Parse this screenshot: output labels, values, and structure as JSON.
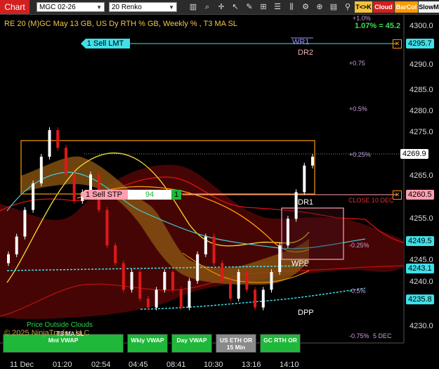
{
  "toolbar": {
    "title": "Chart",
    "instrument": "MGC 02-26",
    "bar_type": "20 Renko",
    "buttons": [
      "T<>K",
      "Cloud",
      "BarCol",
      "SlowM"
    ],
    "icons": [
      "dropdown-arrow",
      "dropdown-arrow",
      "bar-chart-icon",
      "magnify-icon",
      "crosshair-icon",
      "arrow-icon",
      "draw-icon",
      "template-icon",
      "properties-icon",
      "candle-icon",
      "zoom-icon",
      "data-box-icon"
    ]
  },
  "chart_header": {
    "title": "RE 20  (M)GC May 13 GB, US Dy RTH % GB, Weekly % , T3 MA SL",
    "pct_readout": "1.07% = 45.2",
    "top_label": "+1.0%"
  },
  "orders": {
    "limit_label": "1 Sell LMT",
    "limit_price": "4295.7",
    "stop_label": "1 Sell STP",
    "stop_qty_mid": "94",
    "stop_qty": "1",
    "stop_price": "4260.5",
    "close_label": "CLOSE 10 DEC",
    "cancel_glyph": "✕"
  },
  "price_tags": {
    "last": "4269.9",
    "t1": "4249.5",
    "t2": "4243.1",
    "t3": "4235.8"
  },
  "levels": {
    "wr1": "WR1",
    "dr2": "DR2",
    "dr1": "DR1",
    "wpp": "WPP",
    "dpp": "DPP"
  },
  "pct_labels": {
    "p075": "+0.75",
    "p05": "+0.5%",
    "p025": "+0.25%",
    "m025": "-0.25%",
    "m05": "-0.5%",
    "m075": "-0.75%",
    "dec5": "5 DEC"
  },
  "y_axis": [
    "4300.0",
    "4290.0",
    "4285.0",
    "4280.0",
    "4275.0",
    "4265.0",
    "4255.0",
    "4245.0",
    "4240.0",
    "4230.0"
  ],
  "x_axis": [
    "11 Dec",
    "01:20",
    "02:54",
    "04:45",
    "08:41",
    "10:30",
    "13:16",
    "14:10"
  ],
  "bottom_buttons": {
    "mnt_vwap": "Mnt VWAP",
    "wkly_vwap": "Wkly VWAP",
    "day_vwap": "Day VWAP",
    "us_eth": "US ETH OR 15 Min",
    "gc_rth": "GC RTH OR",
    "cloud_text": "Price Outside Clouds",
    "copyright": "© 2025 NinjaTrader, LLC",
    "t3": "T3 MA SL"
  },
  "colors": {
    "accent_red": "#d21f1f",
    "limit_cyan": "#40e0e8",
    "stop_pink": "#ff9fb0",
    "orange": "#ff9900",
    "green_btn": "#1fb83a"
  },
  "chart_data": {
    "type": "line",
    "ylim": [
      4228,
      4302
    ],
    "candles_close": [
      4248,
      4252,
      4258,
      4264,
      4270,
      4276,
      4272,
      4266,
      4260,
      4262,
      4266,
      4258,
      4250,
      4246,
      4240,
      4244,
      4238,
      4236,
      4240,
      4244,
      4240,
      4236,
      4242,
      4248,
      4252,
      4246,
      4242,
      4238,
      4244,
      4240,
      4236,
      4240,
      4244,
      4250,
      4256,
      4262,
      4268,
      4270
    ]
  }
}
